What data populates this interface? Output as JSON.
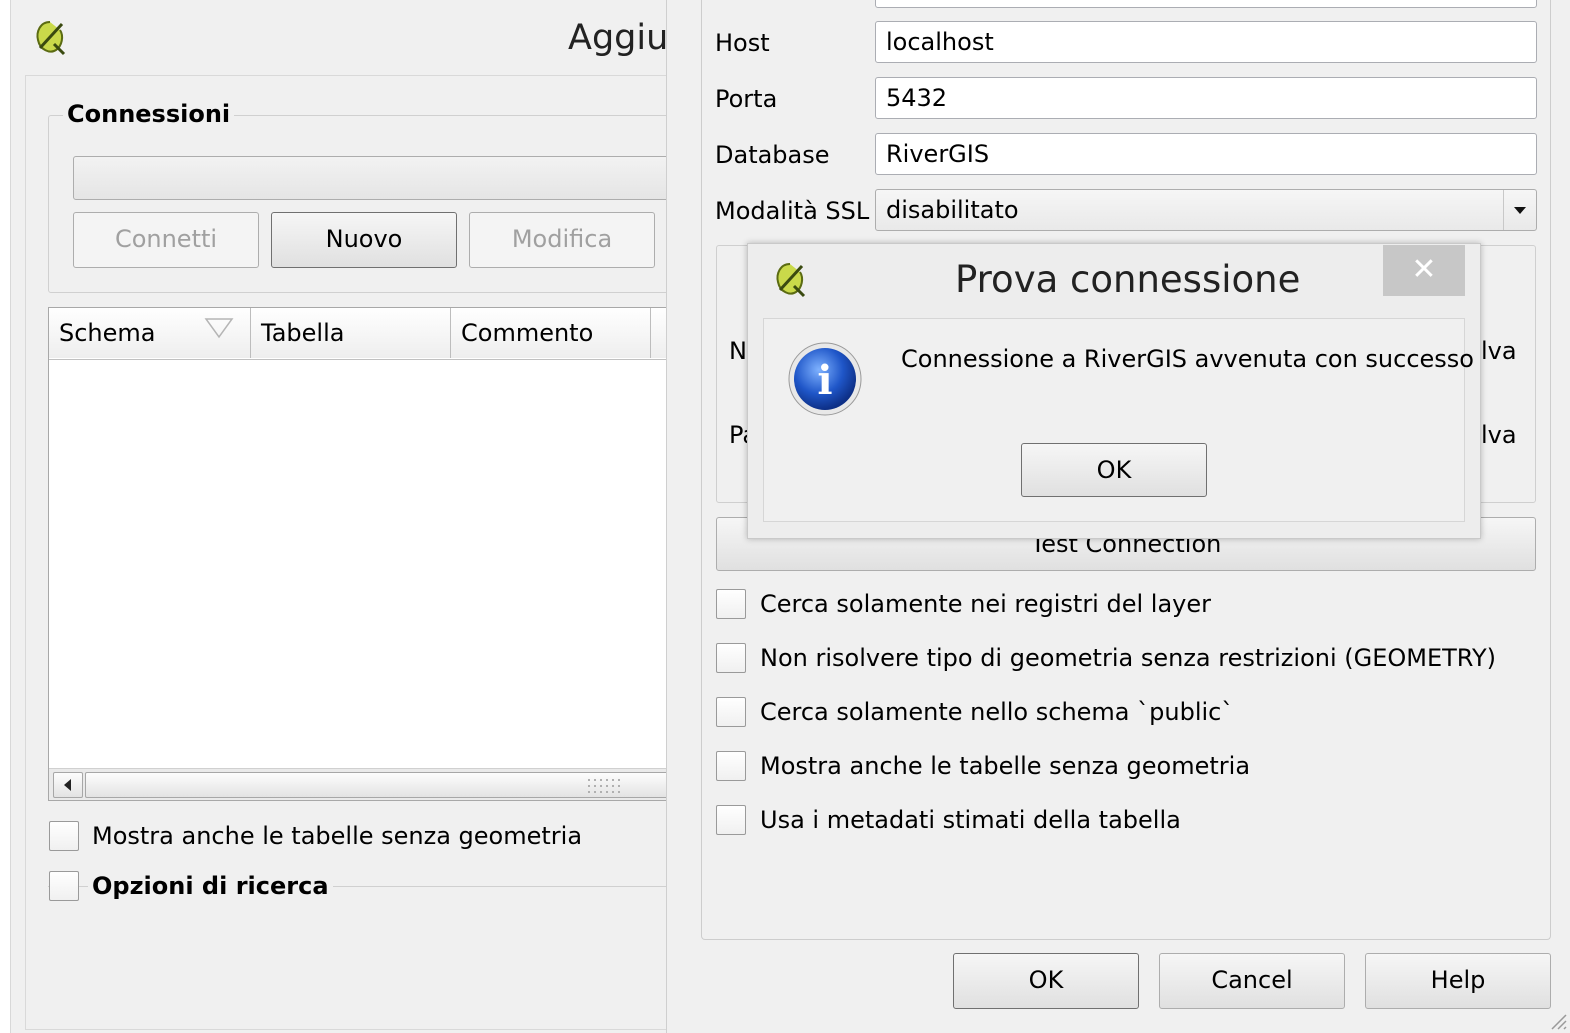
{
  "left": {
    "title": "Aggiu",
    "connections_legend": "Connessioni",
    "buttons": {
      "connect": "Connetti",
      "new": "Nuovo",
      "edit": "Modifica"
    },
    "table_headers": [
      "Schema",
      "Tabella",
      "Commento"
    ],
    "checkbox_no_geom": "Mostra anche le tabelle senza geometria",
    "search_options": "Opzioni di ricerca"
  },
  "right": {
    "fields": {
      "host": {
        "label": "Host",
        "value": "localhost"
      },
      "port": {
        "label": "Porta",
        "value": "5432"
      },
      "database": {
        "label": "Database",
        "value": "RiverGIS"
      },
      "ssl": {
        "label": "Modalità SSL",
        "value": "disabilitato"
      }
    },
    "hidden_fragments": {
      "n": "N",
      "pa": "Pa",
      "salva1": "lva",
      "salva2": "lva"
    },
    "test_connection": "Test Connection",
    "options": [
      "Cerca solamente nei registri del layer",
      "Non risolvere tipo di geometria senza restrizioni (GEOMETRY)",
      "Cerca solamente nello schema `public`",
      "Mostra anche le tabelle senza geometria",
      "Usa i metadati stimati della tabella"
    ],
    "buttons": {
      "ok": "OK",
      "cancel": "Cancel",
      "help": "Help"
    }
  },
  "dialog": {
    "title": "Prova connessione",
    "message": "Connessione a RiverGIS avvenuta con successo",
    "ok": "OK",
    "close_glyph": "✕",
    "info_glyph": "i"
  },
  "icons": {
    "app": "qgis-logo-icon",
    "info": "info-icon",
    "sort": "sort-arrow-icon"
  }
}
